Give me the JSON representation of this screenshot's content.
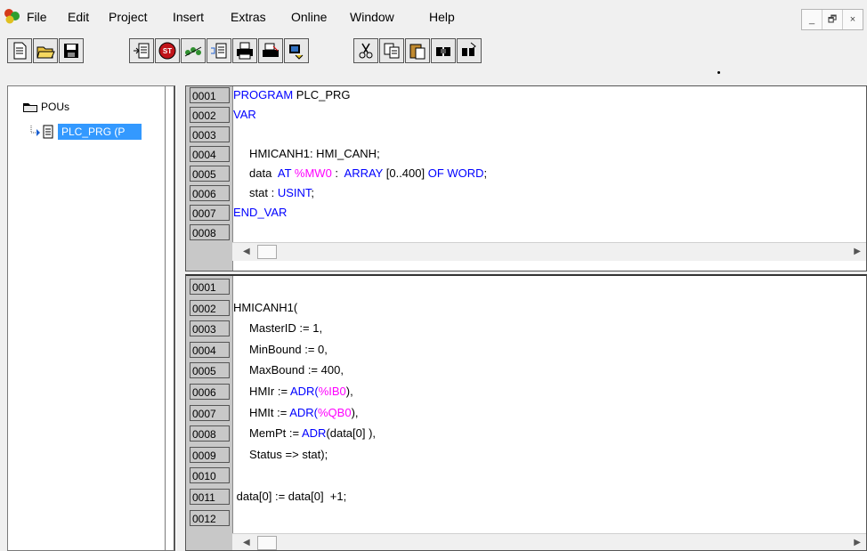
{
  "menu": {
    "items": [
      "File",
      "Edit",
      "Project",
      "Insert",
      "Extras",
      "Online",
      "Window",
      "Help"
    ],
    "window_controls": [
      "_",
      "🗗",
      "×"
    ]
  },
  "toolbar": {
    "buttons": [
      "new-icon",
      "open-icon",
      "save-icon",
      "build-icon",
      "stop-icon",
      "login-icon",
      "insert-icon",
      "print-icon",
      "export-icon",
      "compare-icon",
      "cut-icon",
      "copy-icon",
      "paste-icon",
      "find-icon",
      "replace-icon"
    ]
  },
  "pou_tree": {
    "root_label": "POUs",
    "child_label": "PLC_PRG (P"
  },
  "declaration": {
    "lines": [
      {
        "num": "0001",
        "tokens": [
          {
            "t": "PROGRAM ",
            "c": "kw"
          },
          {
            "t": "PLC_PRG",
            "c": ""
          }
        ]
      },
      {
        "num": "0002",
        "tokens": [
          {
            "t": "VAR",
            "c": "kw"
          }
        ]
      },
      {
        "num": "0003",
        "tokens": []
      },
      {
        "num": "0004",
        "tokens": [
          {
            "t": "     HMICANH1: HMI_CANH;",
            "c": ""
          }
        ]
      },
      {
        "num": "0005",
        "tokens": [
          {
            "t": "     data  ",
            "c": ""
          },
          {
            "t": "AT ",
            "c": "kw"
          },
          {
            "t": "%MW0",
            "c": "mg"
          },
          {
            "t": " :  ",
            "c": ""
          },
          {
            "t": "ARRAY",
            "c": "kw"
          },
          {
            "t": " [0..400] ",
            "c": ""
          },
          {
            "t": "OF WORD",
            "c": "kw"
          },
          {
            "t": ";",
            "c": ""
          }
        ]
      },
      {
        "num": "0006",
        "tokens": [
          {
            "t": "     stat : ",
            "c": ""
          },
          {
            "t": "USINT",
            "c": "kw"
          },
          {
            "t": ";",
            "c": ""
          }
        ]
      },
      {
        "num": "0007",
        "tokens": [
          {
            "t": "END_VAR",
            "c": "kw"
          }
        ]
      },
      {
        "num": "0008",
        "tokens": []
      }
    ]
  },
  "body": {
    "lines": [
      {
        "num": "0001",
        "tokens": []
      },
      {
        "num": "0002",
        "tokens": [
          {
            "t": "HMICANH1(",
            "c": ""
          }
        ]
      },
      {
        "num": "0003",
        "tokens": [
          {
            "t": "     MasterID := 1,",
            "c": ""
          }
        ]
      },
      {
        "num": "0004",
        "tokens": [
          {
            "t": "     MinBound := 0,",
            "c": ""
          }
        ]
      },
      {
        "num": "0005",
        "tokens": [
          {
            "t": "     MaxBound := 400,",
            "c": ""
          }
        ]
      },
      {
        "num": "0006",
        "tokens": [
          {
            "t": "     HMIr := ",
            "c": ""
          },
          {
            "t": "ADR(",
            "c": "kw"
          },
          {
            "t": "%IB0",
            "c": "mg"
          },
          {
            "t": "),",
            "c": ""
          }
        ]
      },
      {
        "num": "0007",
        "tokens": [
          {
            "t": "     HMIt := ",
            "c": ""
          },
          {
            "t": "ADR(",
            "c": "kw"
          },
          {
            "t": "%QB0",
            "c": "mg"
          },
          {
            "t": "),",
            "c": ""
          }
        ]
      },
      {
        "num": "0008",
        "tokens": [
          {
            "t": "     MemPt := ",
            "c": ""
          },
          {
            "t": "ADR",
            "c": "kw"
          },
          {
            "t": "(data[0] ),",
            "c": ""
          }
        ]
      },
      {
        "num": "0009",
        "tokens": [
          {
            "t": "     Status => stat);",
            "c": ""
          }
        ]
      },
      {
        "num": "0010",
        "tokens": []
      },
      {
        "num": "0011",
        "tokens": [
          {
            "t": " data[0] := data[0]  +1;",
            "c": ""
          }
        ]
      },
      {
        "num": "0012",
        "tokens": []
      }
    ]
  }
}
